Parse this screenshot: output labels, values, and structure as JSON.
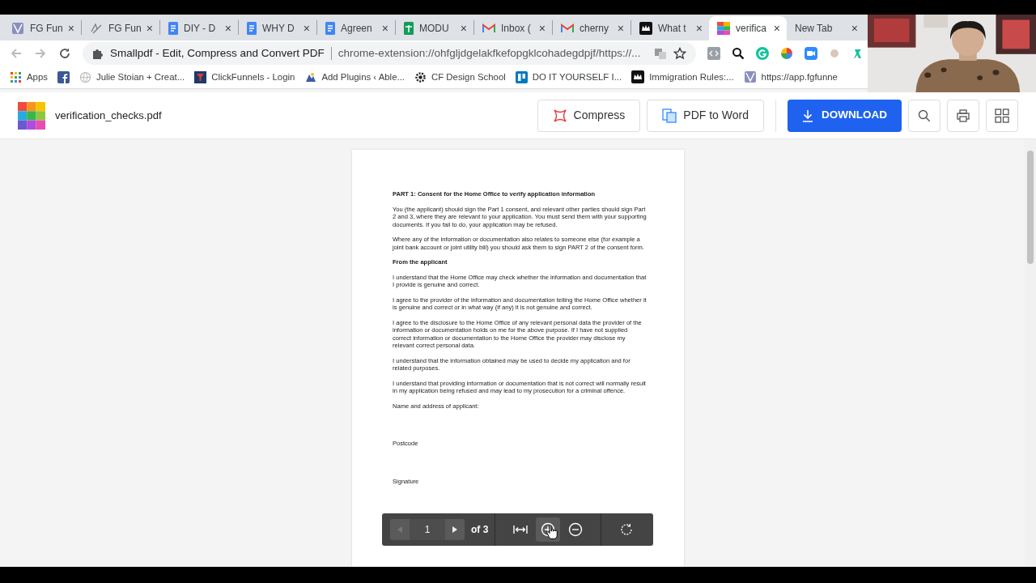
{
  "browser": {
    "tabs": [
      {
        "label": "FG Fun",
        "close": "×",
        "kind": "site",
        "selected": false
      },
      {
        "label": "FG Fun",
        "close": "×",
        "kind": "sketch",
        "selected": false
      },
      {
        "label": "DIY - D",
        "close": "×",
        "kind": "doc",
        "selected": false
      },
      {
        "label": "WHY D",
        "close": "×",
        "kind": "doc",
        "selected": false
      },
      {
        "label": "Agreen",
        "close": "×",
        "kind": "doc",
        "selected": false
      },
      {
        "label": "MODU",
        "close": "×",
        "kind": "sheet",
        "selected": false
      },
      {
        "label": "Inbox (",
        "close": "×",
        "kind": "mail",
        "selected": false
      },
      {
        "label": "cherny",
        "close": "×",
        "kind": "mail",
        "selected": false
      },
      {
        "label": "What t",
        "close": "×",
        "kind": "crown",
        "selected": false
      },
      {
        "label": "verifica",
        "close": "×",
        "kind": "squares",
        "selected": true
      },
      {
        "label": "New Tab",
        "close": "×",
        "kind": "blank",
        "selected": false
      }
    ],
    "address": {
      "title": "Smallpdf - Edit, Compress and Convert PDF",
      "url": "chrome-extension://ohfgljdgelakfkefopgklcohadegdpjf/https://..."
    },
    "bookmarks": [
      {
        "label": "Apps",
        "kind": "grid"
      },
      {
        "kind": "fb"
      },
      {
        "label": "Julie Stoian + Creat...",
        "kind": "globe"
      },
      {
        "label": "ClickFunnels - Login",
        "kind": "cf"
      },
      {
        "label": "Add Plugins ‹ Able...",
        "kind": "wp"
      },
      {
        "label": "CF Design School",
        "kind": "gear"
      },
      {
        "label": "DO IT YOURSELF I...",
        "kind": "board"
      },
      {
        "label": "Immigration Rules:...",
        "kind": "crown"
      },
      {
        "label": "https://app.fgfunne",
        "kind": "site"
      }
    ]
  },
  "app": {
    "file_name": "verification_checks.pdf",
    "compress": "Compress",
    "pdf_to_word": "PDF to Word",
    "download": "DOWNLOAD"
  },
  "document": {
    "blocks": [
      {
        "kind": "heading",
        "text": "PART 1: Consent for the Home Office to verify application information"
      },
      {
        "kind": "paragraph",
        "text": "You (the applicant) should sign the Part 1 consent, and relevant other parties should sign Part 2 and 3, where they are relevant to your application.  You must send them with your supporting documents.  If you fail to do, your application may be refused."
      },
      {
        "kind": "paragraph",
        "text": "Where any of the information or documentation also relates to someone else (for example a joint bank account or joint utility bill) you should ask them to sign PART 2 of the consent form."
      },
      {
        "kind": "heading",
        "text": "From the applicant"
      },
      {
        "kind": "paragraph",
        "text": "I understand that the Home Office may check whether the information and documentation that I provide is genuine and correct."
      },
      {
        "kind": "paragraph",
        "text": "I agree to the provider of the information and documentation telling the Home Office whether it is genuine and correct or in what way (if any) it is not genuine and correct."
      },
      {
        "kind": "paragraph",
        "text": "I agree to the disclosure to the Home Office of any relevant personal data the provider of the information or documentation holds on me for the above purpose.  If I have not supplied correct information or documentation to the Home Office the provider may disclose my relevant correct personal data."
      },
      {
        "kind": "paragraph",
        "text": "I understand that the information obtained may be used to decide my application and for related purposes."
      },
      {
        "kind": "paragraph",
        "text": "I understand that providing information or documentation that is not correct will normally result in my application being refused and may lead to my prosecution for a criminal offence."
      },
      {
        "kind": "field",
        "text": "Name and address of applicant:"
      },
      {
        "kind": "field",
        "text": "Postcode"
      },
      {
        "kind": "field",
        "text": "Signature"
      }
    ]
  },
  "viewer_toolbar": {
    "prev_disabled": true,
    "next_disabled": false,
    "page": "1",
    "page_count": "of 3",
    "zoom_in_hovered": true
  }
}
